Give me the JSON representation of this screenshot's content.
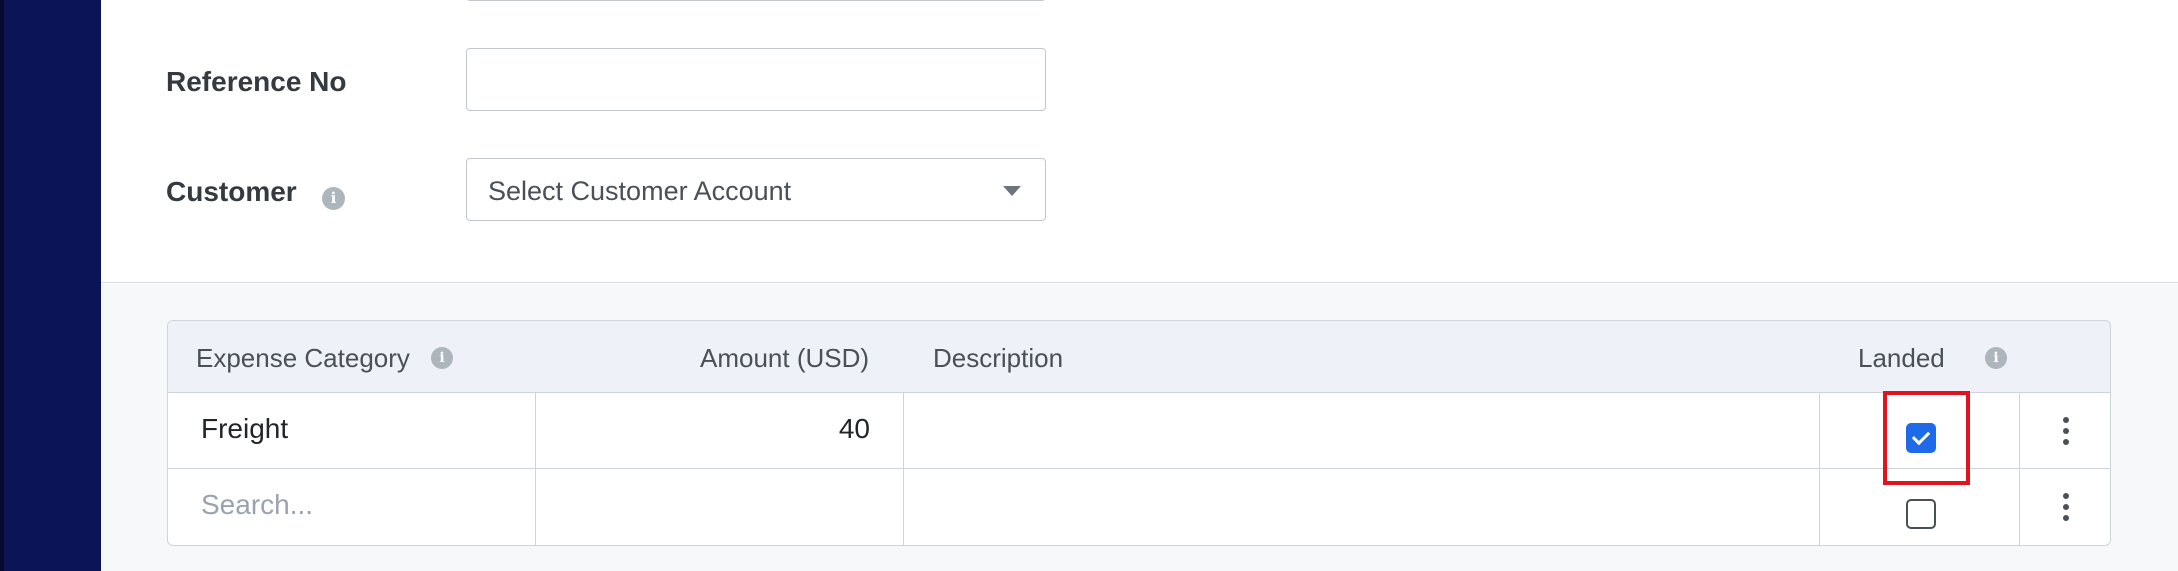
{
  "form": {
    "reference_no_label": "Reference No",
    "reference_no_value": "",
    "customer_label": "Customer",
    "customer_placeholder": "Select Customer Account"
  },
  "expense_table": {
    "headers": {
      "category": "Expense Category",
      "amount": "Amount (USD)",
      "description": "Description",
      "landed": "Landed"
    },
    "rows": [
      {
        "category": "Freight",
        "amount": "40",
        "description": "",
        "landed": true
      },
      {
        "category": "",
        "category_placeholder": "Search...",
        "amount": "",
        "description": "",
        "landed": false
      }
    ]
  },
  "icons": {
    "info": "info-icon",
    "dropdown": "caret-down-icon",
    "row_menu": "vertical-ellipsis-icon",
    "info_glyph": "i"
  },
  "colors": {
    "sidebar": "#0b1457",
    "checkbox_checked": "#1f6ae8",
    "highlight": "#e0141e"
  }
}
